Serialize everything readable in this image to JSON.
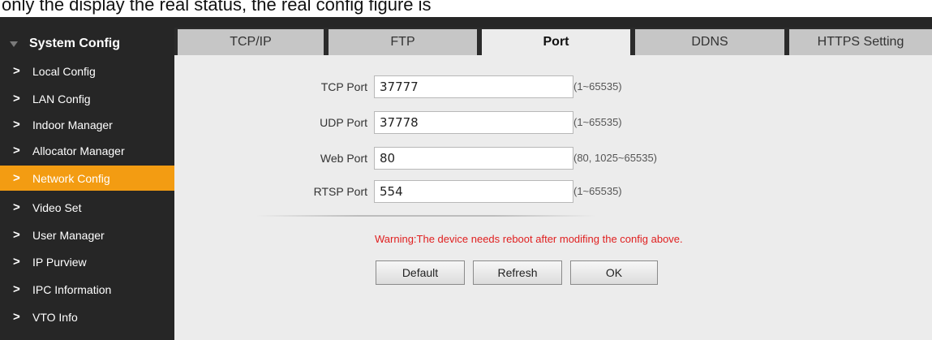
{
  "caption": "only the display the real status, the real config figure is",
  "sidebar": {
    "title": "System Config",
    "items": [
      {
        "label": "Local Config",
        "active": false
      },
      {
        "label": "LAN Config",
        "active": false
      },
      {
        "label": "Indoor Manager",
        "active": false
      },
      {
        "label": "Allocator Manager",
        "active": false
      },
      {
        "label": "Network Config",
        "active": true
      },
      {
        "label": "Video Set",
        "active": false
      },
      {
        "label": "User Manager",
        "active": false
      },
      {
        "label": "IP Purview",
        "active": false
      },
      {
        "label": "IPC Information",
        "active": false
      },
      {
        "label": "VTO Info",
        "active": false
      }
    ]
  },
  "tabs": [
    {
      "label": "TCP/IP",
      "active": false
    },
    {
      "label": "FTP",
      "active": false
    },
    {
      "label": "Port",
      "active": true
    },
    {
      "label": "DDNS",
      "active": false
    },
    {
      "label": "HTTPS Setting",
      "active": false
    }
  ],
  "form": {
    "tcp": {
      "label": "TCP Port",
      "value": "37777",
      "range": "(1~65535)"
    },
    "udp": {
      "label": "UDP Port",
      "value": "37778",
      "range": "(1~65535)"
    },
    "web": {
      "label": "Web Port",
      "value": "80",
      "range": "(80, 1025~65535)"
    },
    "rtsp": {
      "label": "RTSP Port",
      "value": "554",
      "range": "(1~65535)"
    }
  },
  "warning": "Warning:The device needs reboot after modifing the config above.",
  "buttons": {
    "default": "Default",
    "refresh": "Refresh",
    "ok": "OK"
  },
  "colors": {
    "accent": "#f39c12",
    "sidebar_bg": "#262626",
    "warning": "#e02020"
  }
}
